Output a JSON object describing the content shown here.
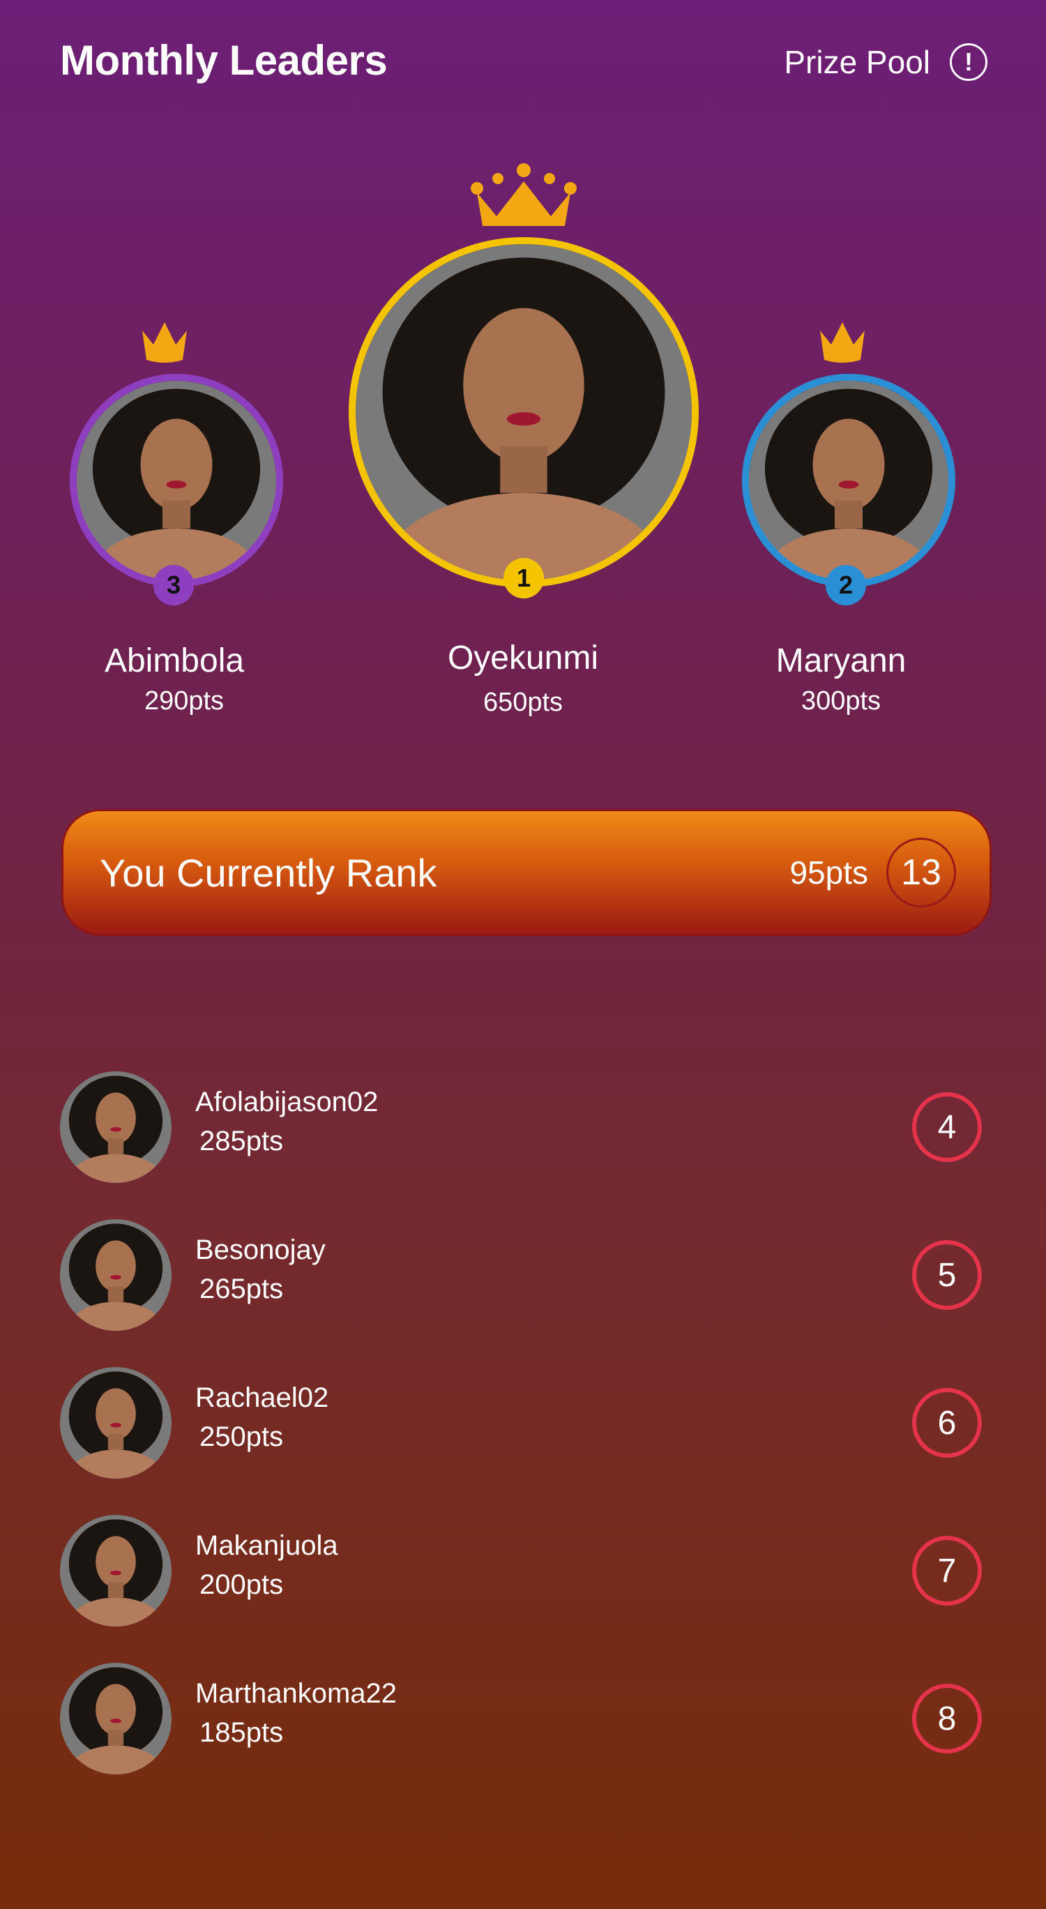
{
  "header": {
    "title": "Monthly Leaders",
    "prize_label": "Prize Pool",
    "info_glyph": "!"
  },
  "podium": [
    {
      "rank": "1",
      "name": "Oyekunmi",
      "points": "650pts",
      "ring_color": "#f5c400"
    },
    {
      "rank": "2",
      "name": "Maryann",
      "points": "300pts",
      "ring_color": "#2b8fd6"
    },
    {
      "rank": "3",
      "name": "Abimbola",
      "points": "290pts",
      "ring_color": "#8e3fbf"
    }
  ],
  "current_rank": {
    "label": "You Currently Rank",
    "points": "95pts",
    "rank": "13"
  },
  "leaders": [
    {
      "name": "Afolabijason02",
      "points": "285pts",
      "rank": "4"
    },
    {
      "name": "Besonojay",
      "points": "265pts",
      "rank": "5"
    },
    {
      "name": "Rachael02",
      "points": "250pts",
      "rank": "6"
    },
    {
      "name": "Makanjuola",
      "points": "200pts",
      "rank": "7"
    },
    {
      "name": "Marthankoma22",
      "points": "185pts",
      "rank": "8"
    }
  ],
  "colors": {
    "crown": "#f3a712",
    "rank_circle": "#e6334c"
  }
}
